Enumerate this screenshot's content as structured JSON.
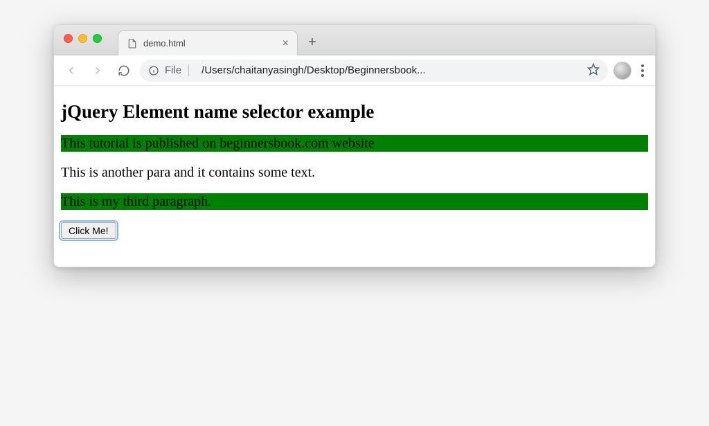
{
  "window": {
    "tab": {
      "title": "demo.html"
    }
  },
  "addressbar": {
    "scheme": "File",
    "path": "/Users/chaitanyasingh/Desktop/Beginnersbook..."
  },
  "page": {
    "heading": "jQuery Element name selector example",
    "p1": "This tutorial is published on beginnersbook.com website",
    "p2": "This is another para and it contains some text.",
    "p3": "This is my third paragraph.",
    "button_label": "Click Me!"
  }
}
